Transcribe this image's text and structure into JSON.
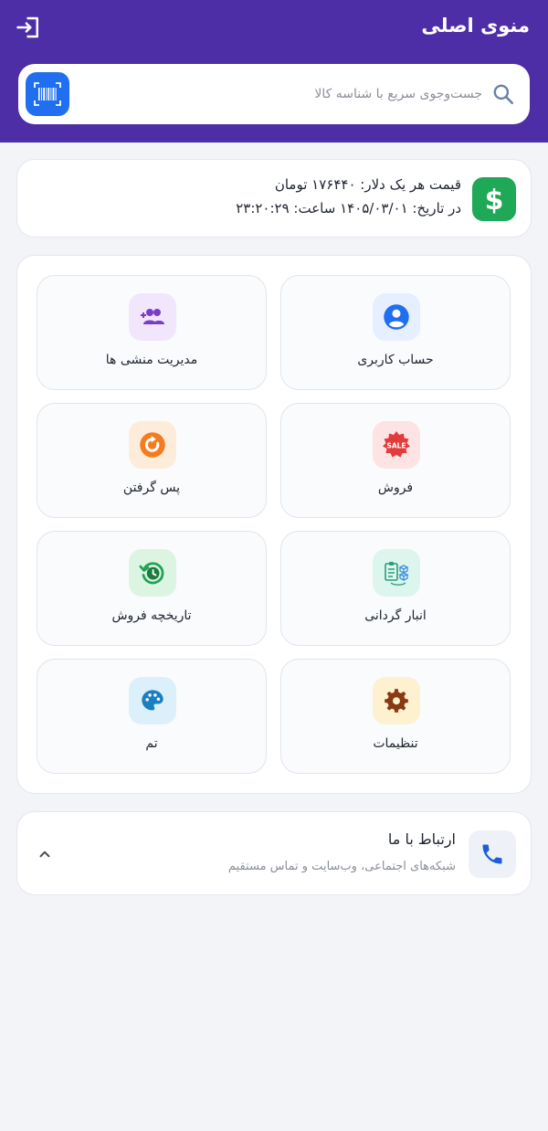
{
  "header": {
    "title": "منوی اصلی",
    "logout_icon": "logout-icon"
  },
  "search": {
    "placeholder": "جست‌وجوی سریع با شناسه کالا",
    "value": "",
    "search_icon": "search-icon",
    "barcode_icon": "barcode-scan-icon"
  },
  "dollar": {
    "price_text": "قیمت هر یک دلار: ۱۷۶۴۴۰ تومان",
    "date_text": "در تاریخ: ۱۴۰۵/۰۳/۰۱ ساعت: ۲۳:۲۰:۲۹",
    "icon": "dollar-icon"
  },
  "menu": {
    "items": [
      {
        "label": "حساب کاربری",
        "icon": "account-icon",
        "icon_bg": "#e6efff",
        "icon_color": "#1f6ff0"
      },
      {
        "label": "مدیریت منشی ها",
        "icon": "add-group-icon",
        "icon_bg": "#f1e6fb",
        "icon_color": "#7d3cc8"
      },
      {
        "label": "فروش",
        "icon": "sale-badge-icon",
        "icon_bg": "#fde3e3",
        "icon_color": "#e33b3b"
      },
      {
        "label": "پس گرفتن",
        "icon": "return-icon",
        "icon_bg": "#fdecd9",
        "icon_color": "#f47c1e"
      },
      {
        "label": "انبار گردانی",
        "icon": "inventory-icon",
        "icon_bg": "#dcf6ee",
        "icon_color": "#2a9c7a"
      },
      {
        "label": "تاریخچه فروش",
        "icon": "history-icon",
        "icon_bg": "#dcf5e3",
        "icon_color": "#21a355"
      },
      {
        "label": "تنظیمات",
        "icon": "gear-icon",
        "icon_bg": "#fdf1cf",
        "icon_color": "#8a3a12"
      },
      {
        "label": "تم",
        "icon": "palette-icon",
        "icon_bg": "#dcf0fb",
        "icon_color": "#1a7fc1"
      }
    ]
  },
  "contact": {
    "title": "ارتباط با ما",
    "subtitle": "شبکه‌های اجتماعی، وب‌سایت و تماس مستقیم",
    "icon": "phone-icon",
    "chevron_icon": "chevron-up-icon"
  },
  "colors": {
    "header_bg": "#4d2ea7",
    "page_bg": "#f3f4f8",
    "accent_blue": "#1f6ff0",
    "dollar_green": "#1fa856"
  }
}
